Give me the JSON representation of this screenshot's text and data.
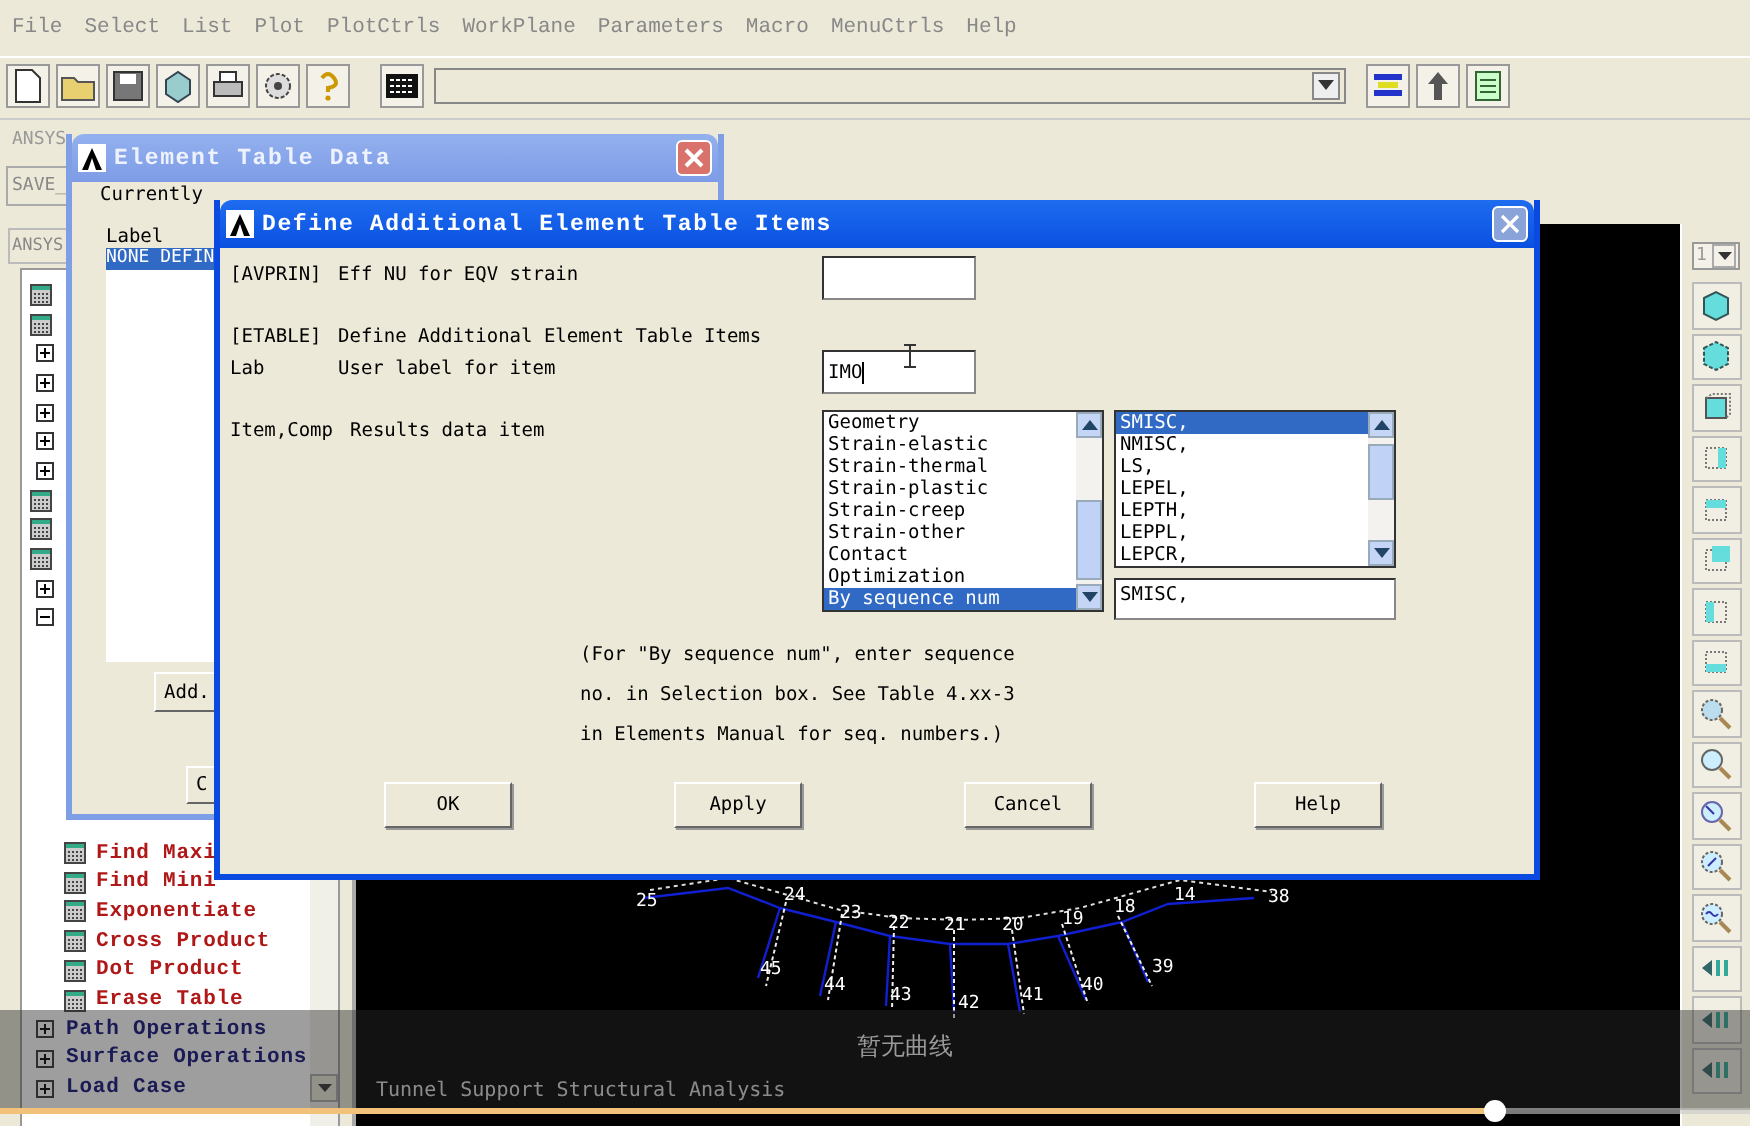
{
  "menu": [
    {
      "label": "File"
    },
    {
      "label": "Select"
    },
    {
      "label": "List"
    },
    {
      "label": "Plot"
    },
    {
      "label": "PlotCtrls"
    },
    {
      "label": "WorkPlane"
    },
    {
      "label": "Parameters"
    },
    {
      "label": "Macro"
    },
    {
      "label": "MenuCtrls"
    },
    {
      "label": "Help"
    }
  ],
  "toolbar": {
    "buttons": [
      {
        "kind": "new"
      },
      {
        "kind": "open"
      },
      {
        "kind": "save"
      },
      {
        "kind": "pan"
      },
      {
        "kind": "print"
      },
      {
        "kind": "report"
      },
      {
        "kind": "help"
      }
    ],
    "end_buttons": [
      {
        "kind": "stack"
      },
      {
        "kind": "raise"
      },
      {
        "kind": "grid"
      }
    ]
  },
  "ansys_toolbar": {
    "title": "ANSYS",
    "button": "SAVE_"
  },
  "main_menu": {
    "title": "ANSYS",
    "items": [
      {
        "kind": "table"
      },
      {
        "kind": "table"
      },
      {
        "kind": "folder",
        "expanded": false
      },
      {
        "kind": "folder",
        "expanded": false
      },
      {
        "kind": "folder",
        "expanded": false
      },
      {
        "kind": "folder",
        "expanded": false
      },
      {
        "kind": "folder",
        "expanded": false
      },
      {
        "kind": "table"
      },
      {
        "kind": "table"
      },
      {
        "kind": "table"
      },
      {
        "kind": "folder",
        "expanded": false
      },
      {
        "kind": "folder",
        "expanded": true,
        "children": [
          {
            "label": "Find Maxi"
          },
          {
            "label": "Find Mini"
          },
          {
            "label": "Exponentiate"
          },
          {
            "label": "Cross Product"
          },
          {
            "label": "Dot Product"
          },
          {
            "label": "Erase Table"
          }
        ]
      },
      {
        "kind": "folder",
        "expanded": false,
        "label": "Path Operations"
      },
      {
        "kind": "folder",
        "expanded": false,
        "label": "Surface Operations"
      },
      {
        "kind": "folder",
        "expanded": false,
        "label": "Load Case"
      }
    ]
  },
  "graphics": {
    "node_labels": [
      "25",
      "24",
      "23",
      "22",
      "21",
      "20",
      "19",
      "18",
      "14",
      "38",
      "45",
      "44",
      "43",
      "42",
      "41",
      "40",
      "39"
    ],
    "title": "Tunnel Support Structural Analysis"
  },
  "view_toolbar": {
    "window": "1",
    "buttons": [
      {
        "kind": "iso"
      },
      {
        "kind": "oblique"
      },
      {
        "kind": "front"
      },
      {
        "kind": "right"
      },
      {
        "kind": "top"
      },
      {
        "kind": "back"
      },
      {
        "kind": "left"
      },
      {
        "kind": "bottom"
      },
      {
        "kind": "fit"
      },
      {
        "kind": "zoom"
      },
      {
        "kind": "zoom-back"
      },
      {
        "kind": "zoom-box"
      },
      {
        "kind": "zoom-win"
      },
      {
        "kind": "move"
      },
      {
        "kind": "move"
      },
      {
        "kind": "move"
      }
    ]
  },
  "element_table_dialog": {
    "title": "Element Table Data",
    "heading": "Currently",
    "column": "Label",
    "rows": [
      {
        "text": "NONE DEFIN",
        "selected": true
      }
    ],
    "buttons": [
      "Add.",
      "C"
    ]
  },
  "define_dialog": {
    "title": "Define Additional Element Table Items",
    "rows": [
      {
        "tag": "[AVPRIN]",
        "label": "Eff NU for EQV strain",
        "kind": "field"
      },
      {
        "tag": "[ETABLE]",
        "label": "Define Additional Element Table Items",
        "kind": "heading"
      },
      {
        "tag": "Lab",
        "label": "User label for item",
        "kind": "field",
        "value": "IMO"
      },
      {
        "tag": "Item,Comp",
        "label": "Results data item",
        "kind": "lists"
      }
    ],
    "item_list": [
      {
        "text": "Geometry",
        "selected": false
      },
      {
        "text": "Strain-elastic",
        "selected": false
      },
      {
        "text": "Strain-thermal",
        "selected": false
      },
      {
        "text": "Strain-plastic",
        "selected": false
      },
      {
        "text": "Strain-creep",
        "selected": false
      },
      {
        "text": "Strain-other",
        "selected": false
      },
      {
        "text": "Contact",
        "selected": false
      },
      {
        "text": "Optimization",
        "selected": false
      },
      {
        "text": "By sequence num",
        "selected": true
      }
    ],
    "comp_list": [
      {
        "text": "SMISC,",
        "selected": true
      },
      {
        "text": "NMISC,",
        "selected": false
      },
      {
        "text": "LS,",
        "selected": false
      },
      {
        "text": "LEPEL,",
        "selected": false
      },
      {
        "text": "LEPTH,",
        "selected": false
      },
      {
        "text": "LEPPL,",
        "selected": false
      },
      {
        "text": "LEPCR,",
        "selected": false
      }
    ],
    "selection": "SMISC,",
    "note": [
      "(For \"By sequence num\", enter sequence",
      "no. in Selection box.  See Table 4.xx-3",
      "in Elements Manual for seq. numbers.)"
    ],
    "buttons": [
      "OK",
      "Apply",
      "Cancel",
      "Help"
    ]
  },
  "video_overlay": {
    "message": "暂无曲线",
    "progress": {
      "level": 0.854
    }
  }
}
